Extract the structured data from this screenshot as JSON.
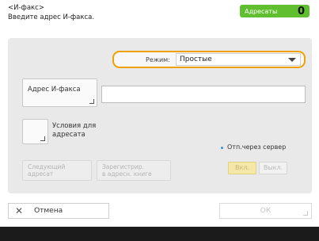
{
  "header": {
    "title_line1": "<И-факс>",
    "title_line2": "Введите адрес И-факса.",
    "recipients_label": "Адресаты",
    "recipients_count": "0"
  },
  "mode": {
    "label": "Режим:",
    "selected": "Простые"
  },
  "address": {
    "button_label": "Адрес И-факса",
    "value": ""
  },
  "conditions": {
    "label_line1": "Условия для",
    "label_line2": "адресата"
  },
  "actions": {
    "next_line1": "Следующий",
    "next_line2": "адресат",
    "register_line1": "Зарегистрир.",
    "register_line2": "в адресн. книге"
  },
  "server": {
    "label": "Отп.через сервер",
    "on_label": "Вкл.",
    "off_label": "Выкл."
  },
  "footer": {
    "cancel_label": "Отмена",
    "ok_label": "ОК"
  },
  "colors": {
    "accent_green": "#5fbf2f",
    "focus_orange": "#f0a000",
    "on_button": "#f5e7a8"
  }
}
